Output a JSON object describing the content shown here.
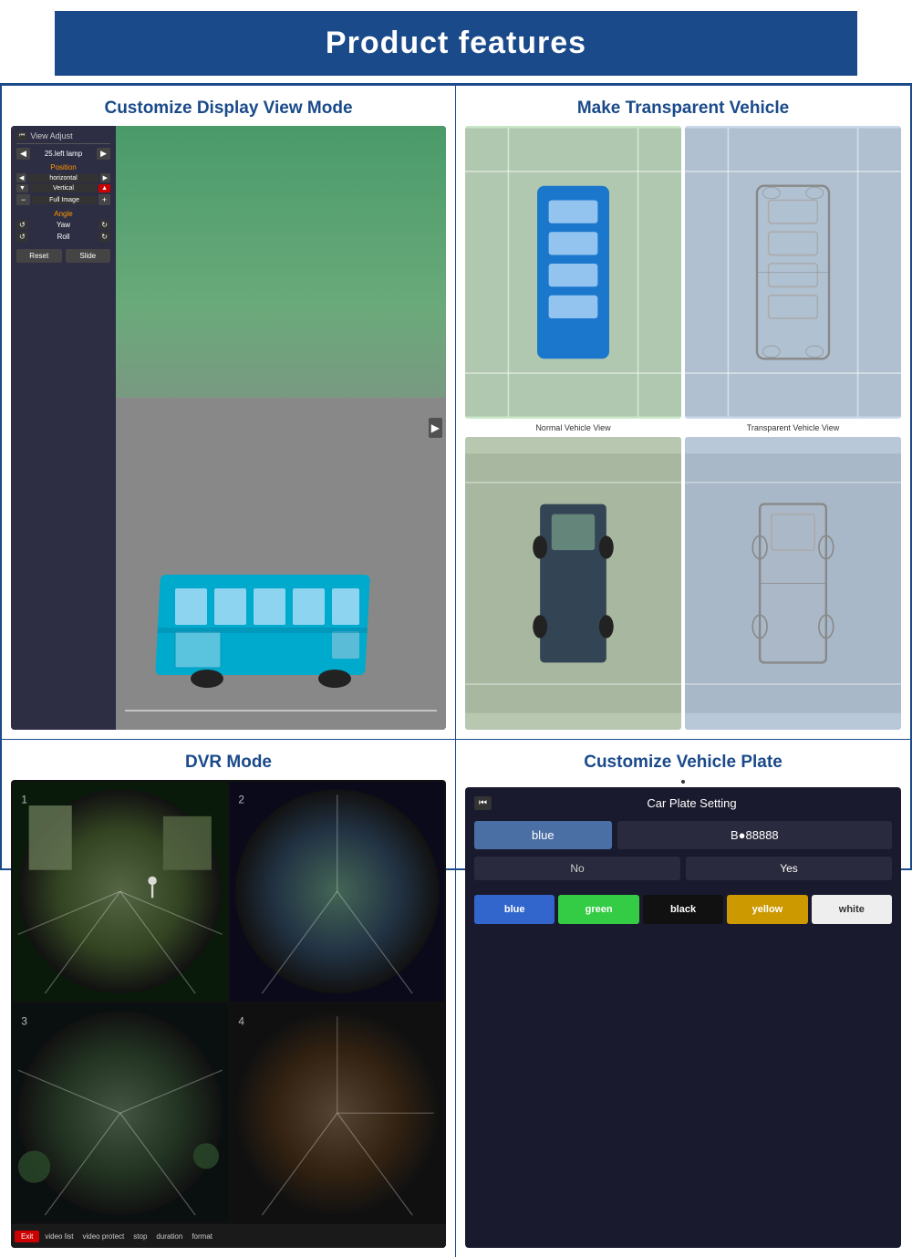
{
  "header": {
    "title": "Product features",
    "bg_color": "#1a4a8a",
    "text_color": "#ffffff"
  },
  "cells": {
    "cell1": {
      "title": "Customize Display View Mode",
      "panel": {
        "header": "View Adjust",
        "camera_label": "25.left lamp",
        "position_label": "Position",
        "horizontal_label": "horizontal",
        "vertical_label": "Vertical",
        "full_image_label": "Full Image",
        "angle_label": "Angle",
        "yaw_label": "Yaw",
        "roll_label": "Roll",
        "reset_btn": "Reset",
        "slide_btn": "Slide"
      }
    },
    "cell2": {
      "title": "Make Transparent Vehicle",
      "normal_label": "Normal Vehicle View",
      "transparent_label": "Transparent Vehicle View"
    },
    "cell3": {
      "title": "DVR Mode",
      "toolbar": {
        "exit_btn": "Exit",
        "video_list": "video list",
        "video_protect": "video protect",
        "stop": "stop",
        "duration": "duration",
        "format": "format"
      }
    },
    "cell4": {
      "title": "Customize Vehicle Plate",
      "screen_title": "Car Plate Setting",
      "color_label": "blue",
      "plate_value": "B●88888",
      "no_label": "No",
      "yes_label": "Yes",
      "colors": [
        {
          "name": "blue",
          "label": "blue",
          "class": "color-blue"
        },
        {
          "name": "green",
          "label": "green",
          "class": "color-green"
        },
        {
          "name": "black",
          "label": "black",
          "class": "color-black"
        },
        {
          "name": "yellow",
          "label": "yellow",
          "class": "color-yellow"
        },
        {
          "name": "white",
          "label": "white",
          "class": "color-white"
        }
      ]
    }
  }
}
